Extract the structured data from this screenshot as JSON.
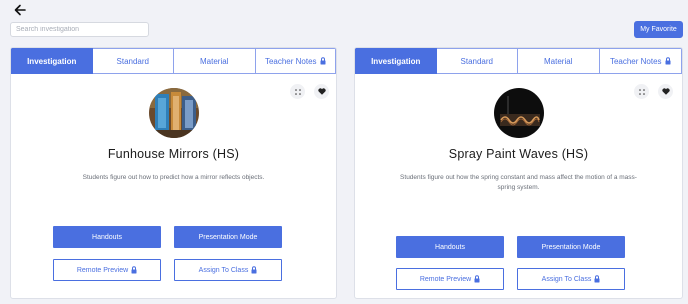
{
  "search": {
    "placeholder": "Search investigation"
  },
  "header": {
    "favorite_label": "My Favorite"
  },
  "cards": [
    {
      "tabs": [
        "Investigation",
        "Standard",
        "Material",
        "Teacher Notes"
      ],
      "title": "Funhouse Mirrors (HS)",
      "description": "Students figure out how to predict how a mirror reflects objects.",
      "buttons": {
        "handouts": "Handouts",
        "presentation": "Presentation Mode",
        "remote": "Remote Preview",
        "assign": "Assign To Class"
      }
    },
    {
      "tabs": [
        "Investigation",
        "Standard",
        "Material",
        "Teacher Notes"
      ],
      "title": "Spray Paint Waves (HS)",
      "description": "Students figure out how the spring constant and mass affect the motion of a mass-spring system.",
      "buttons": {
        "handouts": "Handouts",
        "presentation": "Presentation Mode",
        "remote": "Remote Preview",
        "assign": "Assign To Class"
      }
    }
  ],
  "colors": {
    "accent": "#4a6fe0",
    "background": "#f1f2f7"
  },
  "icons": [
    "arrow-left-icon",
    "lock-icon",
    "grid-dots-icon",
    "heart-icon"
  ]
}
